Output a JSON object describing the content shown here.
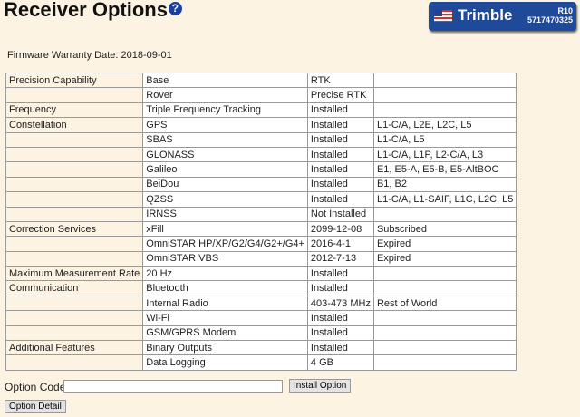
{
  "title": "Receiver Options",
  "help_icon": "?",
  "badge": {
    "brand": "Trimble",
    "model": "R10",
    "serial": "5717470325"
  },
  "warranty": "Firmware Warranty Date: 2018-09-01",
  "rows": [
    [
      "Precision Capability",
      "Base",
      "RTK",
      ""
    ],
    [
      "",
      "Rover",
      "Precise RTK",
      ""
    ],
    [
      "Frequency",
      "Triple Frequency Tracking",
      "Installed",
      ""
    ],
    [
      "Constellation",
      "GPS",
      "Installed",
      "L1-C/A, L2E, L2C, L5"
    ],
    [
      "",
      "SBAS",
      "Installed",
      "L1-C/A, L5"
    ],
    [
      "",
      "GLONASS",
      "Installed",
      "L1-C/A, L1P, L2-C/A, L3"
    ],
    [
      "",
      "Galileo",
      "Installed",
      "E1, E5-A, E5-B, E5-AltBOC"
    ],
    [
      "",
      "BeiDou",
      "Installed",
      "B1, B2"
    ],
    [
      "",
      "QZSS",
      "Installed",
      "L1-C/A, L1-SAIF, L1C, L2C, L5"
    ],
    [
      "",
      "IRNSS",
      "Not Installed",
      ""
    ],
    [
      "Correction Services",
      "xFill",
      "2099-12-08",
      "Subscribed"
    ],
    [
      "",
      "OmniSTAR HP/XP/G2/G4/G2+/G4+",
      "2016-4-1",
      "Expired"
    ],
    [
      "",
      "OmniSTAR VBS",
      "2012-7-13",
      "Expired"
    ],
    [
      "Maximum Measurement Rate",
      "20 Hz",
      "Installed",
      ""
    ],
    [
      "Communication",
      "Bluetooth",
      "Installed",
      ""
    ],
    [
      "",
      "Internal Radio",
      "403-473 MHz",
      "Rest of World"
    ],
    [
      "",
      "Wi-Fi",
      "Installed",
      ""
    ],
    [
      "",
      "GSM/GPRS Modem",
      "Installed",
      ""
    ],
    [
      "Additional Features",
      "Binary Outputs",
      "Installed",
      ""
    ],
    [
      "",
      "Data Logging",
      "4 GB",
      ""
    ]
  ],
  "option_code": {
    "label": "Option Code:",
    "value": ""
  },
  "install_button": "Install Option",
  "detail_button": "Option Detail"
}
